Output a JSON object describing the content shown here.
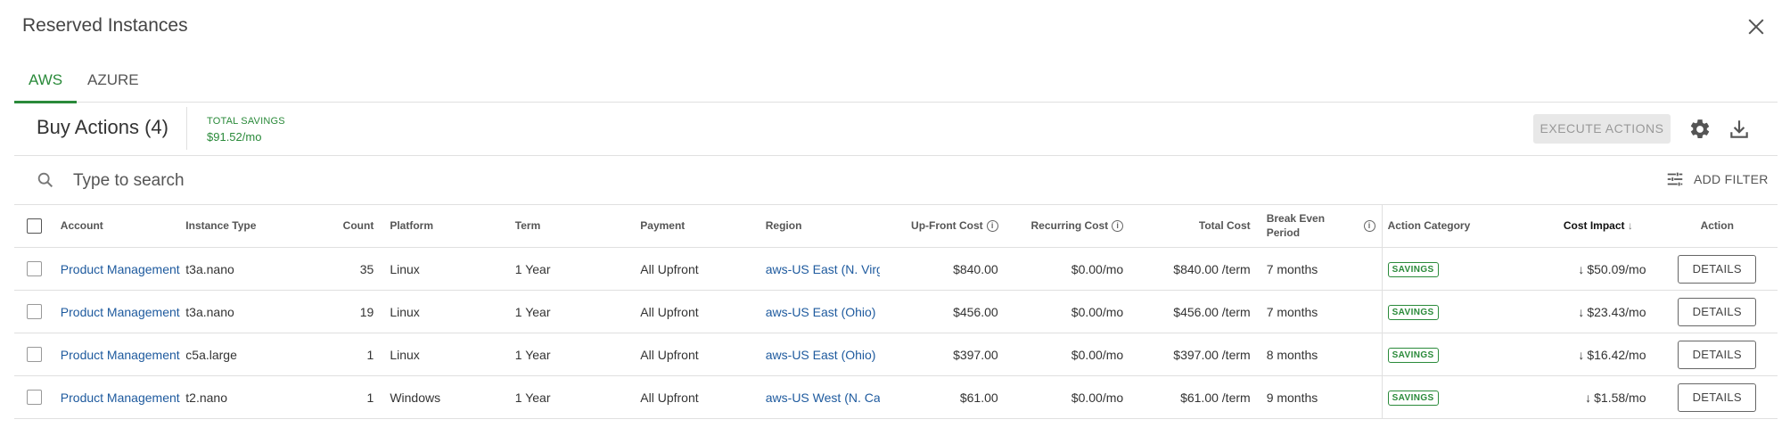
{
  "window": {
    "title": "Reserved Instances"
  },
  "tabs": [
    {
      "label": "AWS"
    },
    {
      "label": "AZURE"
    }
  ],
  "actionbar": {
    "title": "Buy Actions (4)",
    "total_savings_label": "TOTAL SAVINGS",
    "total_savings_value": "$91.52/mo",
    "execute_label": "EXECUTE ACTIONS"
  },
  "search": {
    "placeholder": "Type to search",
    "add_filter_label": "ADD FILTER"
  },
  "table": {
    "headers": {
      "account": "Account",
      "instance_type": "Instance Type",
      "count": "Count",
      "platform": "Platform",
      "term": "Term",
      "payment": "Payment",
      "region": "Region",
      "upfront_cost": "Up-Front Cost",
      "recurring_cost": "Recurring Cost",
      "total_cost": "Total Cost",
      "break_even": "Break Even Period",
      "action_category": "Action Category",
      "cost_impact": "Cost Impact",
      "action": "Action"
    },
    "rows": [
      {
        "account": "Product Management",
        "instance_type": "t3a.nano",
        "count": "35",
        "platform": "Linux",
        "term": "1 Year",
        "payment": "All Upfront",
        "region": "aws-US East (N. Virginia)",
        "upfront_cost": "$840.00",
        "recurring_cost": "$0.00/mo",
        "total_cost": "$840.00 /term",
        "break_even": "7 months",
        "action_category": "SAVINGS",
        "cost_impact": "$50.09/mo",
        "action": "DETAILS"
      },
      {
        "account": "Product Management",
        "instance_type": "t3a.nano",
        "count": "19",
        "platform": "Linux",
        "term": "1 Year",
        "payment": "All Upfront",
        "region": "aws-US East (Ohio)",
        "upfront_cost": "$456.00",
        "recurring_cost": "$0.00/mo",
        "total_cost": "$456.00 /term",
        "break_even": "7 months",
        "action_category": "SAVINGS",
        "cost_impact": "$23.43/mo",
        "action": "DETAILS"
      },
      {
        "account": "Product Management",
        "instance_type": "c5a.large",
        "count": "1",
        "platform": "Linux",
        "term": "1 Year",
        "payment": "All Upfront",
        "region": "aws-US East (Ohio)",
        "upfront_cost": "$397.00",
        "recurring_cost": "$0.00/mo",
        "total_cost": "$397.00 /term",
        "break_even": "8 months",
        "action_category": "SAVINGS",
        "cost_impact": "$16.42/mo",
        "action": "DETAILS"
      },
      {
        "account": "Product Management",
        "instance_type": "t2.nano",
        "count": "1",
        "platform": "Windows",
        "term": "1 Year",
        "payment": "All Upfront",
        "region": "aws-US West (N. California)",
        "upfront_cost": "$61.00",
        "recurring_cost": "$0.00/mo",
        "total_cost": "$61.00 /term",
        "break_even": "9 months",
        "action_category": "SAVINGS",
        "cost_impact": "$1.58/mo",
        "action": "DETAILS"
      }
    ]
  },
  "colors": {
    "accent": "#2a8a3a",
    "link": "#1e5a9e"
  }
}
